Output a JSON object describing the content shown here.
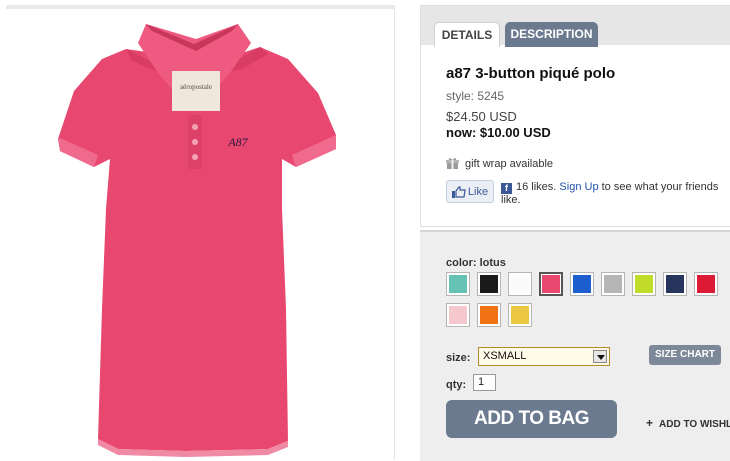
{
  "product": {
    "title": "a87 3-button piqué polo",
    "style": "style: 5245",
    "price_original": "$24.50 USD",
    "price_now": "now: $10.00 USD"
  },
  "tabs": [
    {
      "label": "DETAILS",
      "active": true
    },
    {
      "label": "DESCRIPTION",
      "active": false
    }
  ],
  "gift_wrap": {
    "label": "gift wrap available",
    "icon": "gift-icon"
  },
  "facebook": {
    "like_label": "Like",
    "likes_text": "16 likes.",
    "signup_link": "Sign Up",
    "signup_suffix": " to see what your friends like."
  },
  "image": {
    "brand_tag": "aéropostale",
    "logo": "A87",
    "shirt_color": "#e8476f"
  },
  "options": {
    "color_label": "color: lotus",
    "swatches": [
      {
        "name": "teal",
        "hex": "#66c2b3"
      },
      {
        "name": "black",
        "hex": "#1a1a1a"
      },
      {
        "name": "white",
        "hex": "#fafafa"
      },
      {
        "name": "lotus",
        "hex": "#e8476f",
        "selected": true
      },
      {
        "name": "blue",
        "hex": "#1e5fd0"
      },
      {
        "name": "heather-gray",
        "hex": "#b6b6b6"
      },
      {
        "name": "lime",
        "hex": "#c2dc2c"
      },
      {
        "name": "navy",
        "hex": "#26345e"
      },
      {
        "name": "red",
        "hex": "#dd1a36"
      },
      {
        "name": "light-pink",
        "hex": "#f4c8cd"
      },
      {
        "name": "orange",
        "hex": "#f07213"
      },
      {
        "name": "yellow",
        "hex": "#ecc741"
      }
    ],
    "size_label": "size:",
    "size_value": "XSMALL",
    "size_chart_label": "SIZE CHART",
    "qty_label": "qty:",
    "qty_value": "1"
  },
  "actions": {
    "add_to_bag": "ADD TO BAG",
    "wishlist": "ADD TO WISHL"
  }
}
